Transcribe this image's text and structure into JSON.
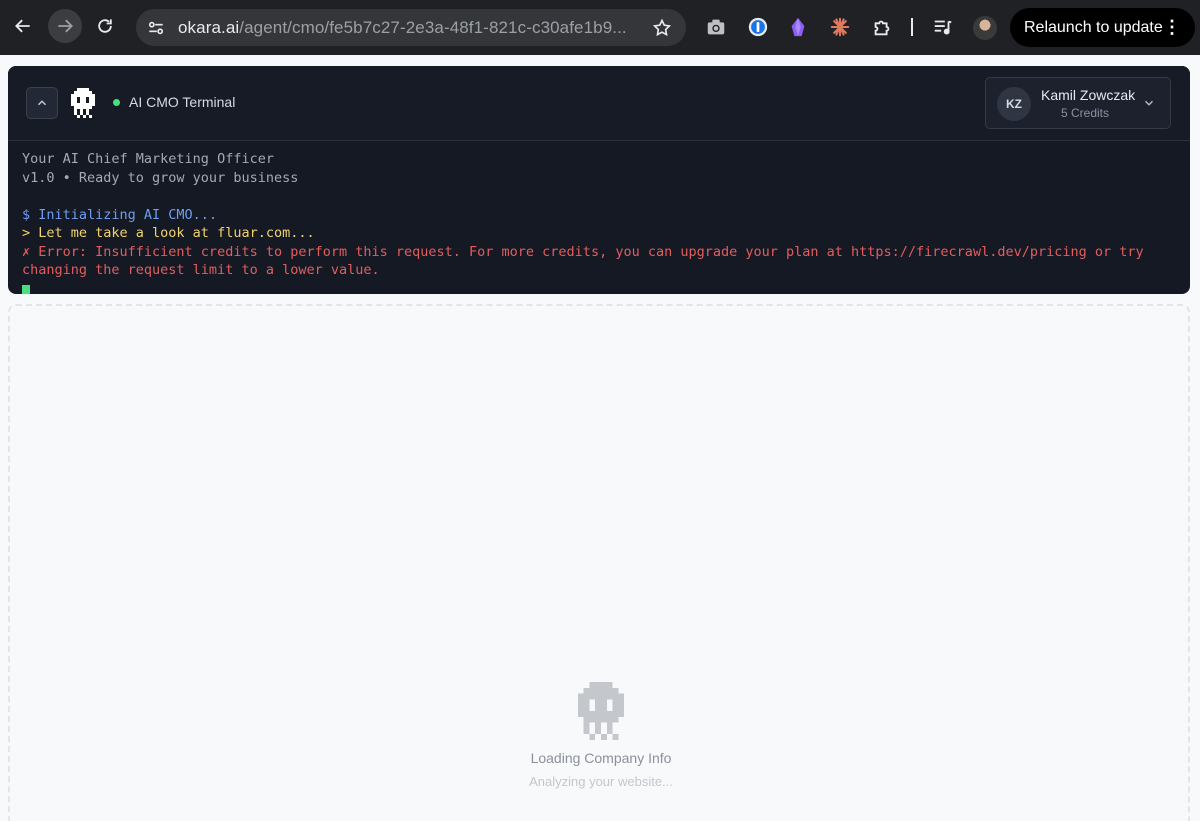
{
  "browser": {
    "url_host": "okara.ai",
    "url_path": "/agent/cmo/fe5b7c27-2e3a-48f1-821c-c30afe1b9...",
    "relaunch_label": "Relaunch to update",
    "extension_icons": [
      "camera-icon",
      "password-manager-icon",
      "crystal-icon",
      "asterisk-icon",
      "puzzle-icon",
      "media-queue-icon"
    ]
  },
  "terminal": {
    "title": "AI CMO Terminal",
    "status_color": "#4ade80",
    "user": {
      "initials": "KZ",
      "name": "Kamil Zowczak",
      "credits": "5 Credits"
    },
    "lines": {
      "heading": "Your AI Chief Marketing Officer",
      "version": "v1.0 • Ready to grow your business",
      "init": "$ Initializing AI CMO...",
      "look": "> Let me take a look at fluar.com...",
      "error": "✗ Error: Insufficient credits to perform this request. For more credits, you can upgrade your plan at https://firecrawl.dev/pricing or try changing the request limit to a lower value."
    }
  },
  "loading": {
    "title": "Loading Company Info",
    "subtitle": "Analyzing your website..."
  },
  "colors": {
    "terminal_bg": "#141924",
    "prompt_blue": "#6f9df0",
    "info_yellow": "#f2d36b",
    "error_red": "#e35d5d"
  }
}
